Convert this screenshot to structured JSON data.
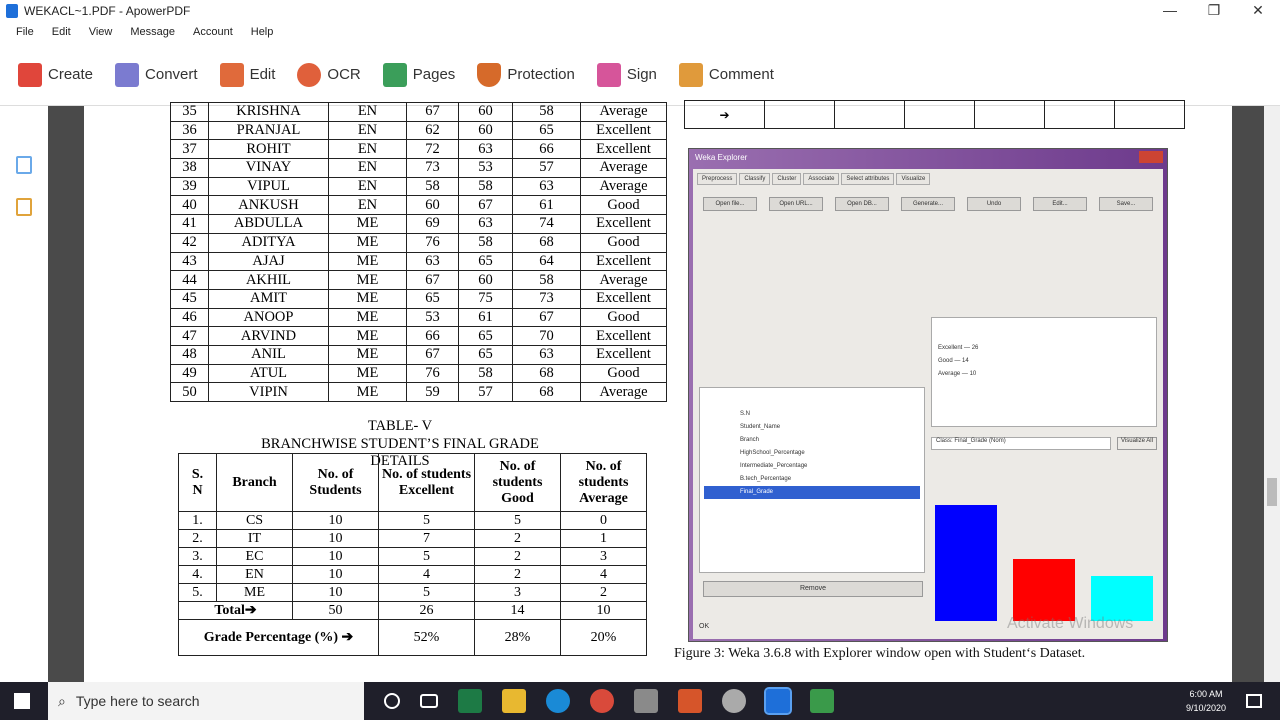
{
  "window": {
    "title": "WEKACL~1.PDF - ApowerPDF",
    "min": "—",
    "max": "❐",
    "close": "✕"
  },
  "menu": [
    "File",
    "Edit",
    "View",
    "Message",
    "Account",
    "Help"
  ],
  "toolbar": [
    {
      "label": "Create",
      "color": "#e0463b"
    },
    {
      "label": "Convert",
      "color": "#7b7bd0"
    },
    {
      "label": "Edit",
      "color": "#e06a3b"
    },
    {
      "label": "OCR",
      "color": "#e0603b"
    },
    {
      "label": "Pages",
      "color": "#3b9e5a"
    },
    {
      "label": "Protection",
      "color": "#d66a2a"
    },
    {
      "label": "Sign",
      "color": "#d6559a"
    },
    {
      "label": "Comment",
      "color": "#e09a3b"
    }
  ],
  "student_table": [
    [
      "35",
      "KRISHNA",
      "EN",
      "67",
      "60",
      "58",
      "Average"
    ],
    [
      "36",
      "PRANJAL",
      "EN",
      "62",
      "60",
      "65",
      "Excellent"
    ],
    [
      "37",
      "ROHIT",
      "EN",
      "72",
      "63",
      "66",
      "Excellent"
    ],
    [
      "38",
      "VINAY",
      "EN",
      "73",
      "53",
      "57",
      "Average"
    ],
    [
      "39",
      "VIPUL",
      "EN",
      "58",
      "58",
      "63",
      "Average"
    ],
    [
      "40",
      "ANKUSH",
      "EN",
      "60",
      "67",
      "61",
      "Good"
    ],
    [
      "41",
      "ABDULLA",
      "ME",
      "69",
      "63",
      "74",
      "Excellent"
    ],
    [
      "42",
      "ADITYA",
      "ME",
      "76",
      "58",
      "68",
      "Good"
    ],
    [
      "43",
      "AJAJ",
      "ME",
      "63",
      "65",
      "64",
      "Excellent"
    ],
    [
      "44",
      "AKHIL",
      "ME",
      "67",
      "60",
      "58",
      "Average"
    ],
    [
      "45",
      "AMIT",
      "ME",
      "65",
      "75",
      "73",
      "Excellent"
    ],
    [
      "46",
      "ANOOP",
      "ME",
      "53",
      "61",
      "67",
      "Good"
    ],
    [
      "47",
      "ARVIND",
      "ME",
      "66",
      "65",
      "70",
      "Excellent"
    ],
    [
      "48",
      "ANIL",
      "ME",
      "67",
      "65",
      "63",
      "Excellent"
    ],
    [
      "49",
      "ATUL",
      "ME",
      "76",
      "58",
      "68",
      "Good"
    ],
    [
      "50",
      "VIPIN",
      "ME",
      "59",
      "57",
      "68",
      "Average"
    ]
  ],
  "table_v": {
    "caption1": "TABLE- V",
    "caption2": "BRANCHWISE STUDENT’S FINAL GRADE DETAILS",
    "headers": [
      "S.\nN",
      "Branch",
      "No. of Students",
      "No. of students Excellent",
      "No. of students Good",
      "No. of students Average"
    ],
    "rows": [
      [
        "1.",
        "CS",
        "10",
        "5",
        "5",
        "0"
      ],
      [
        "2.",
        "IT",
        "10",
        "7",
        "2",
        "1"
      ],
      [
        "3.",
        "EC",
        "10",
        "5",
        "2",
        "3"
      ],
      [
        "4.",
        "EN",
        "10",
        "4",
        "2",
        "4"
      ],
      [
        "5.",
        "ME",
        "10",
        "5",
        "3",
        "2"
      ]
    ],
    "total": [
      "Total➔",
      "50",
      "26",
      "14",
      "10"
    ],
    "pct": [
      "Grade Percentage (%) ➔",
      "52%",
      "28%",
      "20%"
    ]
  },
  "figure_caption": "Figure 3: Weka 3.6.8 with Explorer window open with Student‘s Dataset.",
  "weka": {
    "title": "Weka Explorer",
    "tabs": [
      "Preprocess",
      "Classify",
      "Cluster",
      "Associate",
      "Select attributes",
      "Visualize"
    ],
    "buttons": [
      "Open file...",
      "Open URL...",
      "Open DB...",
      "Generate...",
      "Undo",
      "Edit...",
      "Save..."
    ],
    "attributes": [
      "S.N",
      "Student_Name",
      "Branch",
      "HighSchool_Percentage",
      "Intermediate_Percentage",
      "B.tech_Percentage",
      "Final_Grade"
    ],
    "selected_attribute": "Final_Grade",
    "labels": [
      {
        "label": "Excellent",
        "count": "26"
      },
      {
        "label": "Good",
        "count": "14"
      },
      {
        "label": "Average",
        "count": "10"
      }
    ],
    "class_select": "Class: Final_Grade (Nom)",
    "visualize_btn": "Visualize All",
    "remove_btn": "Remove",
    "status": "OK",
    "watermark": "Activate Windows"
  },
  "chart_data": {
    "type": "bar",
    "categories": [
      "Excellent",
      "Good",
      "Average"
    ],
    "values": [
      26,
      14,
      10
    ],
    "colors": [
      "#0000ff",
      "#ff0000",
      "#00ffff"
    ]
  },
  "taskbar": {
    "search_placeholder": "Type here to search",
    "time": "6:00 AM",
    "date": "9/10/2020"
  }
}
